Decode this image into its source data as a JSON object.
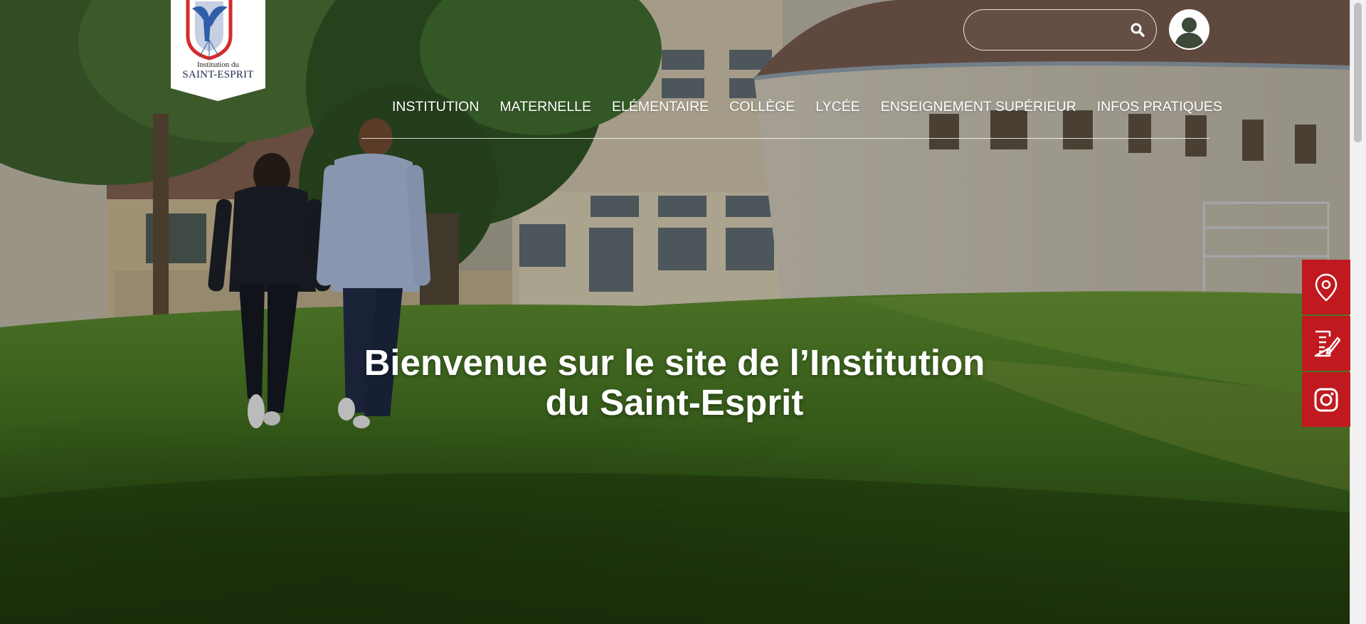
{
  "logo": {
    "line1": "Institution du",
    "line2": "SAINT-ESPRIT"
  },
  "search": {
    "value": "",
    "placeholder": "",
    "button_icon": "search-icon"
  },
  "user": {
    "icon": "user-account-icon"
  },
  "nav": {
    "items": [
      {
        "label": "INSTITUTION"
      },
      {
        "label": "MATERNELLE"
      },
      {
        "label": "ELÉMENTAIRE"
      },
      {
        "label": "COLLÈGE"
      },
      {
        "label": "LYCÉE"
      },
      {
        "label": "ENSEIGNEMENT SUPÉRIEUR"
      },
      {
        "label": "INFOS PRATIQUES"
      }
    ]
  },
  "hero": {
    "title_line1": "Bienvenue sur le site de l’Institution",
    "title_line2": "du Saint-Esprit"
  },
  "side_buttons": [
    {
      "icon": "map-pin-icon"
    },
    {
      "icon": "document-edit-icon"
    },
    {
      "icon": "instagram-icon"
    }
  ],
  "colors": {
    "accent": "#c0191f",
    "nav_text": "#ffffff",
    "grass": "#3f6a1f"
  }
}
